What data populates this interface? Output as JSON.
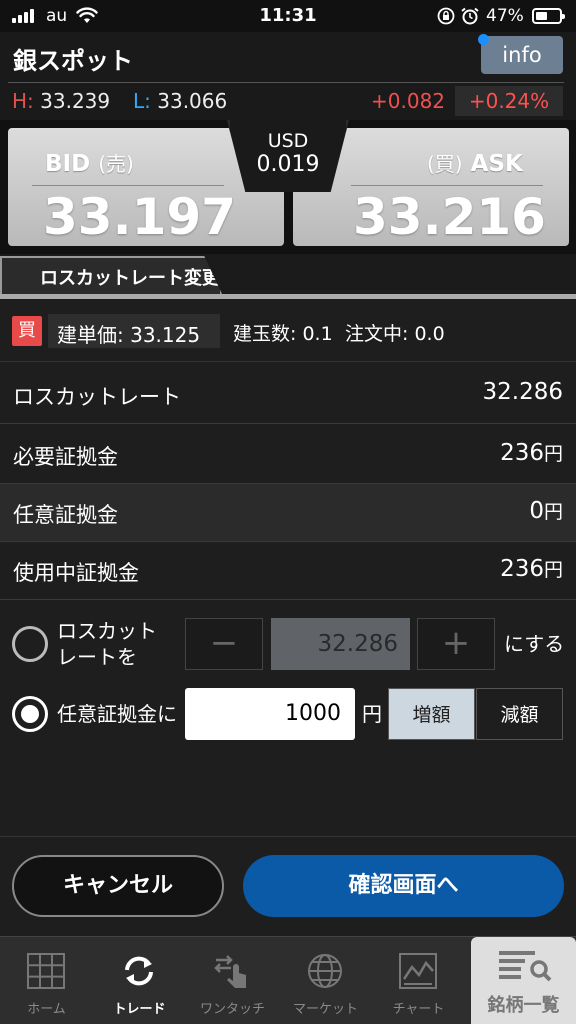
{
  "status_bar": {
    "carrier": "au",
    "time": "11:31",
    "battery": "47%"
  },
  "header": {
    "title": "銀スポット",
    "info_label": "info",
    "high_key": "H:",
    "high": "33.239",
    "low_key": "L:",
    "low": "33.066",
    "change": "+0.082",
    "change_pct": "+0.24%"
  },
  "quote": {
    "bid_label": "BID",
    "bid_sub": "(売)",
    "bid": "33.197",
    "ask_sub": "(買)",
    "ask_label": "ASK",
    "ask": "33.216",
    "currency": "USD",
    "spread": "0.019"
  },
  "tab": {
    "label": "ロスカットレート変更"
  },
  "position": {
    "side": "買",
    "entry_price": "建単価: 33.125",
    "quantity": "建玉数: 0.1",
    "pending": "注文中: 0.0"
  },
  "rows": [
    {
      "label": "ロスカットレート",
      "value": "32.286",
      "unit": ""
    },
    {
      "label": "必要証拠金",
      "value": "236",
      "unit": "円"
    },
    {
      "label": "任意証拠金",
      "value": "0",
      "unit": "円"
    },
    {
      "label": "使用中証拠金",
      "value": "236",
      "unit": "円"
    }
  ],
  "controls": {
    "option1_line1": "ロスカット",
    "option1_line2": "レートを",
    "minus": "−",
    "rate_value": "32.286",
    "plus": "+",
    "option1_suffix": "にする",
    "option2_label": "任意証拠金に",
    "amount": "1000",
    "amount_unit": "円",
    "increase": "増額",
    "decrease": "減額",
    "selected_option": 2
  },
  "actions": {
    "cancel": "キャンセル",
    "confirm": "確認画面へ"
  },
  "tabbar": [
    {
      "label": "ホーム",
      "icon": "grid-icon"
    },
    {
      "label": "トレード",
      "icon": "refresh-icon"
    },
    {
      "label": "ワンタッチ",
      "icon": "touch-icon"
    },
    {
      "label": "マーケット",
      "icon": "globe-icon"
    },
    {
      "label": "チャート",
      "icon": "chart-icon"
    },
    {
      "label": "銘柄一覧",
      "icon": "list-search-icon"
    }
  ]
}
